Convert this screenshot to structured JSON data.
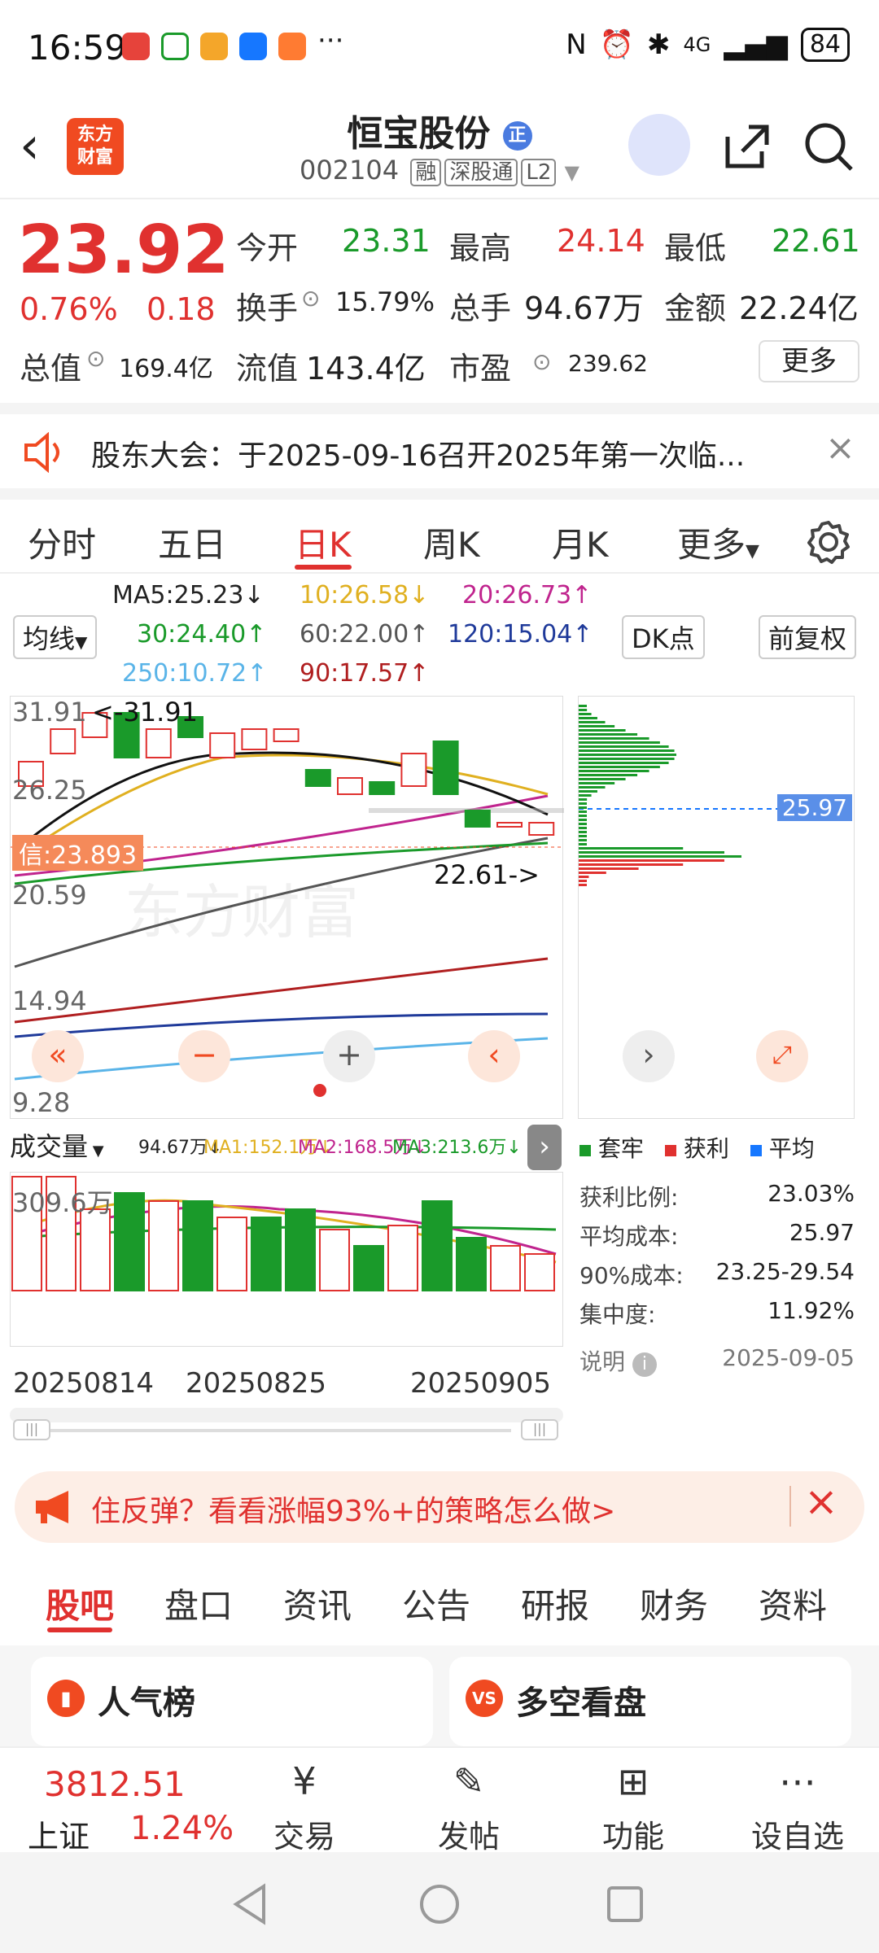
{
  "status": {
    "time": "16:59",
    "network": "4G",
    "battery": "84"
  },
  "header": {
    "logo_text": "东方\n财富",
    "name": "恒宝股份",
    "code": "002104",
    "tags": [
      "融",
      "深股通",
      "L2"
    ]
  },
  "quote": {
    "price": "23.92",
    "change_pct": "0.76%",
    "change": "0.18",
    "open_label": "今开",
    "open": "23.31",
    "high_label": "最高",
    "high": "24.14",
    "low_label": "最低",
    "low": "22.61",
    "turnover_label": "换手",
    "turnover": "15.79%",
    "volume_label": "总手",
    "volume": "94.67万",
    "amount_label": "金额",
    "amount": "22.24亿",
    "mktcap_label": "总值",
    "mktcap": "169.4亿",
    "float_label": "流值",
    "float": "143.4亿",
    "pe_label": "市盈",
    "pe": "239.62",
    "more": "更多"
  },
  "notice": {
    "text": "股东大会：于2025-09-16召开2025年第一次临..."
  },
  "tabs": [
    "分时",
    "五日",
    "日K",
    "周K",
    "月K",
    "更多"
  ],
  "ma": {
    "ma5": "MA5:25.23↓",
    "ma10": "10:26.58↓",
    "ma20": "20:26.73↑",
    "ma30": "30:24.40↑",
    "ma60": "60:22.00↑",
    "ma120": "120:15.04↑",
    "ma250": "250:10.72↑",
    "ma90": "90:17.57↑",
    "junxian": "均线",
    "dk": "DK点",
    "fuquan": "前复权"
  },
  "kchart": {
    "y_labels": [
      "31.91",
      "26.25",
      "20.59",
      "14.94",
      "9.28"
    ],
    "high_mark": "<-31.91",
    "low_mark": "22.61->",
    "xin": "信:23.893",
    "chip_price": "25.97",
    "watermark": "东方财富"
  },
  "vol": {
    "label": "成交量",
    "vol": "94.67万↓",
    "ma1": "MA1:152.1万↓",
    "ma2": "MA2:168.5万↓",
    "ma3": "MA3:213.6万↓",
    "ymax": "309.6万",
    "dates": [
      "20250814",
      "20250825",
      "20250905"
    ]
  },
  "chip": {
    "legend": [
      "套牢",
      "获利",
      "平均"
    ],
    "rows": [
      [
        "获利比例:",
        "23.03%"
      ],
      [
        "平均成本:",
        "25.97"
      ],
      [
        "90%成本:",
        "23.25-29.54"
      ],
      [
        "集中度:",
        "11.92%"
      ]
    ],
    "note": "说明",
    "date": "2025-09-05"
  },
  "promo": {
    "text": "住反弹？看看涨幅93%+的策略怎么做>"
  },
  "subtabs": [
    "股吧",
    "盘口",
    "资讯",
    "公告",
    "研报",
    "财务",
    "资料"
  ],
  "cards": {
    "left": "人气榜",
    "right": "多空看盘"
  },
  "bottom": {
    "index_value": "3812.51",
    "index_name": "上证",
    "index_pct": "1.24%",
    "items": [
      "交易",
      "发帖",
      "功能",
      "设自选"
    ]
  },
  "colors": {
    "up": "#e0312f",
    "down": "#1a9a2a",
    "accent": "#f04a21"
  }
}
